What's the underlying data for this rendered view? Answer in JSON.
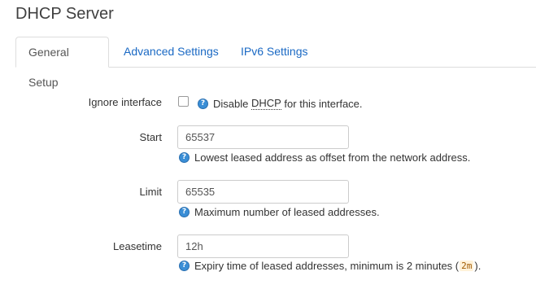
{
  "page": {
    "title": "DHCP Server"
  },
  "tabs": [
    {
      "label": "General Setup",
      "active": true
    },
    {
      "label": "Advanced Settings",
      "active": false
    },
    {
      "label": "IPv6 Settings",
      "active": false
    }
  ],
  "fields": {
    "ignore_interface": {
      "label": "Ignore interface",
      "checked": false,
      "help_prefix": "Disable ",
      "help_abbr": "DHCP",
      "help_suffix": " for this interface."
    },
    "start": {
      "label": "Start",
      "value": "65537",
      "help": "Lowest leased address as offset from the network address."
    },
    "limit": {
      "label": "Limit",
      "value": "65535",
      "help": "Maximum number of leased addresses."
    },
    "leasetime": {
      "label": "Leasetime",
      "value": "12h",
      "help_prefix": "Expiry time of leased addresses, minimum is 2 minutes (",
      "help_code": "2m",
      "help_suffix": ")."
    }
  },
  "icons": {
    "help_glyph": "?"
  },
  "colors": {
    "link": "#1a69c4",
    "help_icon": "#3a8ed6",
    "code_bg": "#fff2d9"
  }
}
